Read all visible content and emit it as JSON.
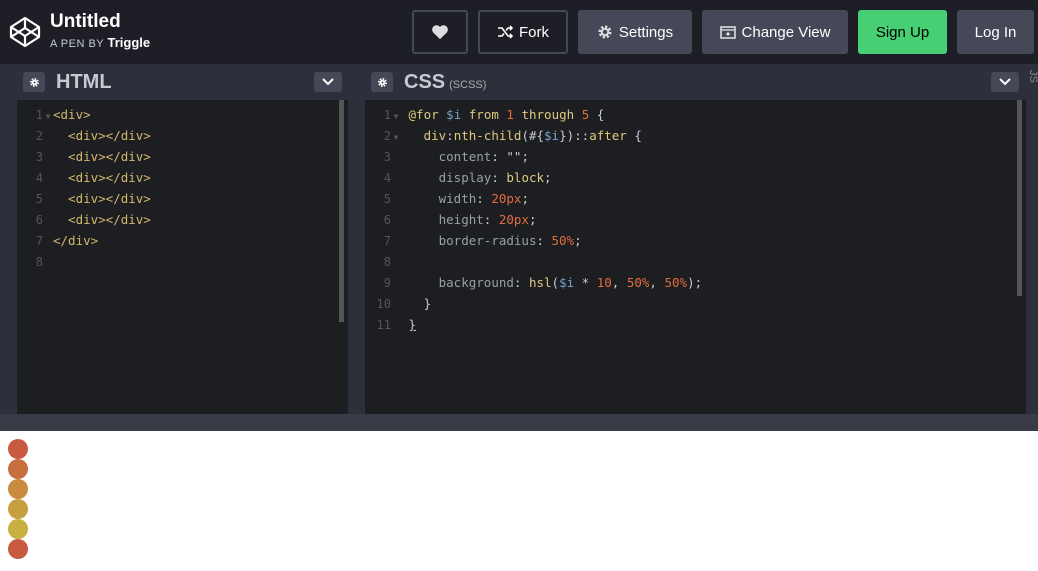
{
  "header": {
    "title": "Untitled",
    "byline_prefix": "A PEN BY",
    "author": "Triggle",
    "fork_label": "Fork",
    "settings_label": "Settings",
    "change_view_label": "Change View",
    "signup_label": "Sign Up",
    "login_label": "Log In"
  },
  "html_panel": {
    "title": "HTML",
    "lines": [
      {
        "n": "1",
        "fold": true
      },
      {
        "n": "2"
      },
      {
        "n": "3"
      },
      {
        "n": "4"
      },
      {
        "n": "5"
      },
      {
        "n": "6"
      },
      {
        "n": "7"
      },
      {
        "n": "8"
      }
    ]
  },
  "css_panel": {
    "title": "CSS",
    "subtitle": "(SCSS)",
    "lines": [
      "1",
      "2",
      "3",
      "4",
      "5",
      "6",
      "7",
      "8",
      "9",
      "10",
      "11"
    ]
  },
  "js_panel": {
    "label": "JS"
  },
  "preview": {
    "dot_colors": [
      "#c85a40",
      "#c86f40",
      "#c88b40",
      "#c89f40",
      "#c8b040",
      "#c85a40"
    ]
  },
  "colors": {
    "accent_green": "#47cf73",
    "header_bg": "#1e1f26",
    "editor_bg": "#1d1e22"
  }
}
